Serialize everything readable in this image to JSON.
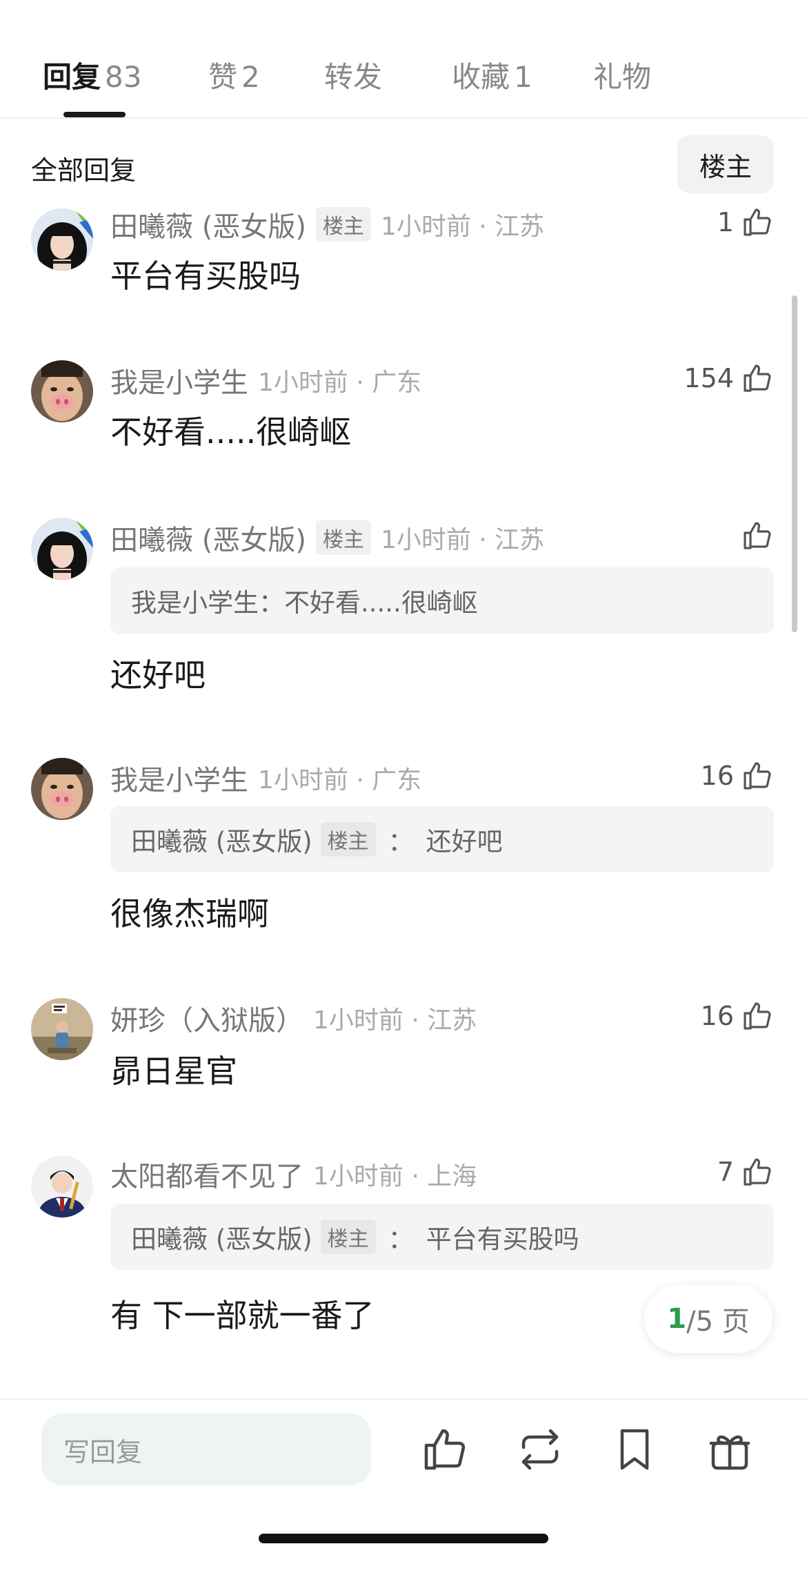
{
  "tabs": [
    {
      "label": "回复",
      "count": "83",
      "active": true
    },
    {
      "label": "赞",
      "count": "2"
    },
    {
      "label": "转发",
      "count": ""
    },
    {
      "label": "收藏",
      "count": "1"
    },
    {
      "label": "礼物",
      "count": ""
    }
  ],
  "filter": {
    "label": "全部回复",
    "op_button": "楼主"
  },
  "comments": [
    {
      "name": "田曦薇 (恶女版)",
      "badge": "楼主",
      "time": "1小时前 · 江苏",
      "likes": "1",
      "text": "平台有买股吗",
      "avatar": "avatar-girl"
    },
    {
      "name": "我是小学生",
      "time": "1小时前 · 广东",
      "likes": "154",
      "text": "不好看.....很崎岖",
      "avatar": "avatar-pig-nose"
    },
    {
      "name": "田曦薇 (恶女版)",
      "badge": "楼主",
      "time": "1小时前 · 江苏",
      "likes": "",
      "quote": {
        "name": "我是小学生",
        "sep": "：",
        "text": "不好看.....很崎岖"
      },
      "text": "还好吧",
      "avatar": "avatar-girl"
    },
    {
      "name": "我是小学生",
      "time": "1小时前 · 广东",
      "likes": "16",
      "quote": {
        "name": "田曦薇 (恶女版)",
        "badge": "楼主",
        "sep": "：",
        "text": "还好吧"
      },
      "text": "很像杰瑞啊",
      "avatar": "avatar-pig-nose"
    },
    {
      "name": "妍珍（入狱版）",
      "time": "1小时前 · 江苏",
      "likes": "16",
      "text": "昴日星官",
      "avatar": "avatar-room"
    },
    {
      "name": "太阳都看不见了",
      "time": "1小时前 · 上海",
      "likes": "7",
      "quote": {
        "name": "田曦薇 (恶女版)",
        "badge": "楼主",
        "sep": "：",
        "text": "平台有买股吗"
      },
      "text": "有 下一部就一番了",
      "avatar": "avatar-uniform"
    }
  ],
  "pager": {
    "current": "1",
    "total": "/5 页"
  },
  "bottom_bar": {
    "reply_placeholder": "写回复",
    "icons": [
      "thumbs-up-icon",
      "repost-icon",
      "bookmark-icon",
      "gift-icon"
    ]
  },
  "colors": {
    "accent": "#2e9b4e",
    "input_bg": "#eef4ef"
  }
}
